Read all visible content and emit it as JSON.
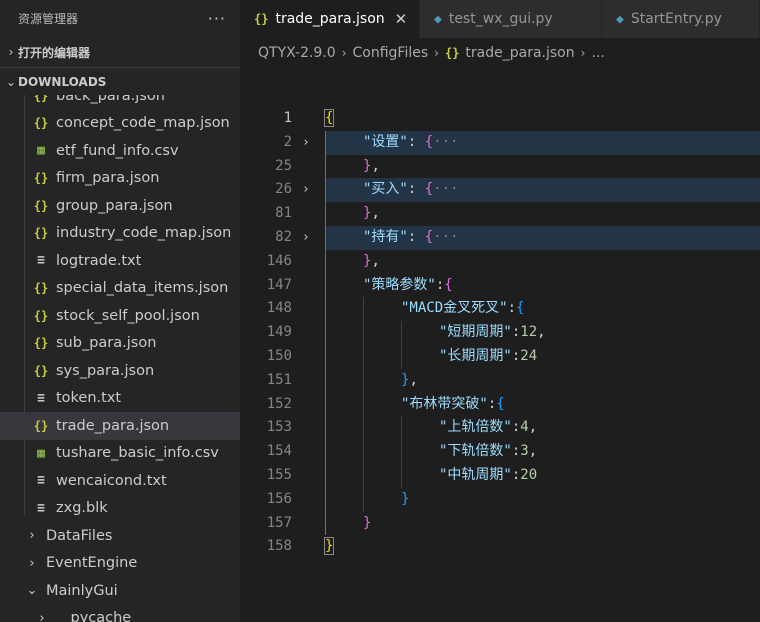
{
  "sidebar": {
    "title": "资源管理器",
    "more": "···",
    "open_editors": "打开的编辑器",
    "downloads": "DOWNLOADS",
    "items": [
      {
        "type": "json",
        "icon": "{}",
        "label": "back_para.json"
      },
      {
        "type": "json",
        "icon": "{}",
        "label": "concept_code_map.json"
      },
      {
        "type": "csv",
        "icon": "▦",
        "label": "etf_fund_info.csv"
      },
      {
        "type": "json",
        "icon": "{}",
        "label": "firm_para.json"
      },
      {
        "type": "json",
        "icon": "{}",
        "label": "group_para.json"
      },
      {
        "type": "json",
        "icon": "{}",
        "label": "industry_code_map.json"
      },
      {
        "type": "txt",
        "icon": "≡",
        "label": "logtrade.txt"
      },
      {
        "type": "json",
        "icon": "{}",
        "label": "special_data_items.json"
      },
      {
        "type": "json",
        "icon": "{}",
        "label": "stock_self_pool.json"
      },
      {
        "type": "json",
        "icon": "{}",
        "label": "sub_para.json"
      },
      {
        "type": "json",
        "icon": "{}",
        "label": "sys_para.json"
      },
      {
        "type": "txt",
        "icon": "≡",
        "label": "token.txt"
      },
      {
        "type": "json",
        "icon": "{}",
        "label": "trade_para.json",
        "selected": true
      },
      {
        "type": "csv",
        "icon": "▦",
        "label": "tushare_basic_info.csv"
      },
      {
        "type": "txt",
        "icon": "≡",
        "label": "wencaicond.txt"
      },
      {
        "type": "txt",
        "icon": "≡",
        "label": "zxg.blk"
      }
    ],
    "folders": [
      {
        "label": "DataFiles",
        "chevron": "›",
        "depth": 1
      },
      {
        "label": "EventEngine",
        "chevron": "›",
        "depth": 1
      },
      {
        "label": "MainlyGui",
        "chevron": "⌄",
        "depth": 1
      },
      {
        "label": "__pycache__",
        "chevron": "›",
        "depth": 2
      }
    ]
  },
  "tabs": [
    {
      "icon": "{}",
      "label": "trade_para.json",
      "close": "✕",
      "active": true
    },
    {
      "icon": "◆",
      "label": "test_wx_gui.py"
    },
    {
      "icon": "◆",
      "label": "StartEntry.py"
    }
  ],
  "breadcrumb": {
    "parts": [
      "QTYX-2.9.0",
      "ConfigFiles",
      "trade_para.json",
      "..."
    ],
    "json_icon": "{}"
  },
  "code": [
    {
      "n": "1",
      "fold": "",
      "text": "{",
      "cur": true
    },
    {
      "n": "2",
      "fold": "›",
      "text": "\"设置\": {···",
      "hl": true
    },
    {
      "n": "25",
      "fold": "",
      "text": "},"
    },
    {
      "n": "26",
      "fold": "›",
      "text": "\"买入\": {···",
      "hl": true
    },
    {
      "n": "81",
      "fold": "",
      "text": "},"
    },
    {
      "n": "82",
      "fold": "›",
      "text": "\"持有\": {···",
      "hl": true
    },
    {
      "n": "146",
      "fold": "",
      "text": "},"
    },
    {
      "n": "147",
      "fold": "",
      "text": "\"策略参数\":{"
    },
    {
      "n": "148",
      "fold": "",
      "text": "\"MACD金叉死叉\":{"
    },
    {
      "n": "149",
      "fold": "",
      "text": "\"短期周期\":12,"
    },
    {
      "n": "150",
      "fold": "",
      "text": "\"长期周期\":24"
    },
    {
      "n": "151",
      "fold": "",
      "text": "},"
    },
    {
      "n": "152",
      "fold": "",
      "text": "\"布林带突破\":{"
    },
    {
      "n": "153",
      "fold": "",
      "text": "\"上轨倍数\":4,"
    },
    {
      "n": "154",
      "fold": "",
      "text": "\"下轨倍数\":3,"
    },
    {
      "n": "155",
      "fold": "",
      "text": "\"中轨周期\":20"
    },
    {
      "n": "156",
      "fold": "",
      "text": "}"
    },
    {
      "n": "157",
      "fold": "",
      "text": "}"
    },
    {
      "n": "158",
      "fold": "",
      "text": "}"
    }
  ],
  "colors": {
    "sidebar_bg": "#252526",
    "editor_bg": "#1e1e1e",
    "json_icon": "#cbcb41",
    "csv_icon": "#8dc149",
    "python_icon": "#519aba",
    "key": "#9cdcfe",
    "number": "#b5cea8",
    "bracket_level1": "#ffd700",
    "bracket_level2": "#da70d6",
    "bracket_level3": "#179fff"
  }
}
